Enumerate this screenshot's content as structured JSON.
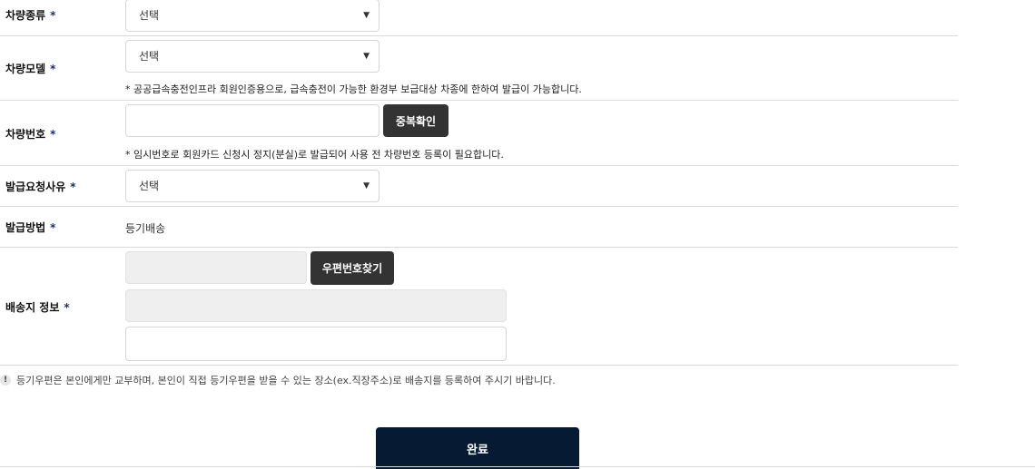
{
  "form": {
    "vehicle_type": {
      "label": "차량종류",
      "required_mark": "*",
      "value": "선택"
    },
    "vehicle_model": {
      "label": "차량모델",
      "required_mark": "*",
      "value": "선택",
      "note": "* 공공급속충전인프라 회원인증용으로, 급속충전이 가능한 환경부 보급대상 차종에 한하여 발급이 가능합니다."
    },
    "vehicle_number": {
      "label": "차량번호",
      "required_mark": "*",
      "value": "",
      "check_button": "중복확인",
      "note": "* 임시번호로 회원카드 신청시 정지(분실)로 발급되어 사용 전 차량번호 등록이 필요합니다."
    },
    "issue_reason": {
      "label": "발급요청사유",
      "required_mark": "*",
      "value": "선택"
    },
    "issue_method": {
      "label": "발급방법",
      "required_mark": "*",
      "value": "등기배송"
    },
    "shipping": {
      "label": "배송지 정보",
      "required_mark": "*",
      "postcode_button": "우편번호찾기",
      "postcode": "",
      "address": "",
      "address_detail": ""
    }
  },
  "notice": {
    "icon": "exclamation-icon",
    "text": "등기우편은 본인에게만 교부하며, 본인이 직접 등기우편을 받을 수 있는 장소(ex.직장주소)로 배송지를 등록하여 주시기 바랍니다."
  },
  "submit_label": "완료",
  "colors": {
    "submit_bg": "#071a33",
    "button_dark": "#333333",
    "required": "#1a2f6b"
  }
}
